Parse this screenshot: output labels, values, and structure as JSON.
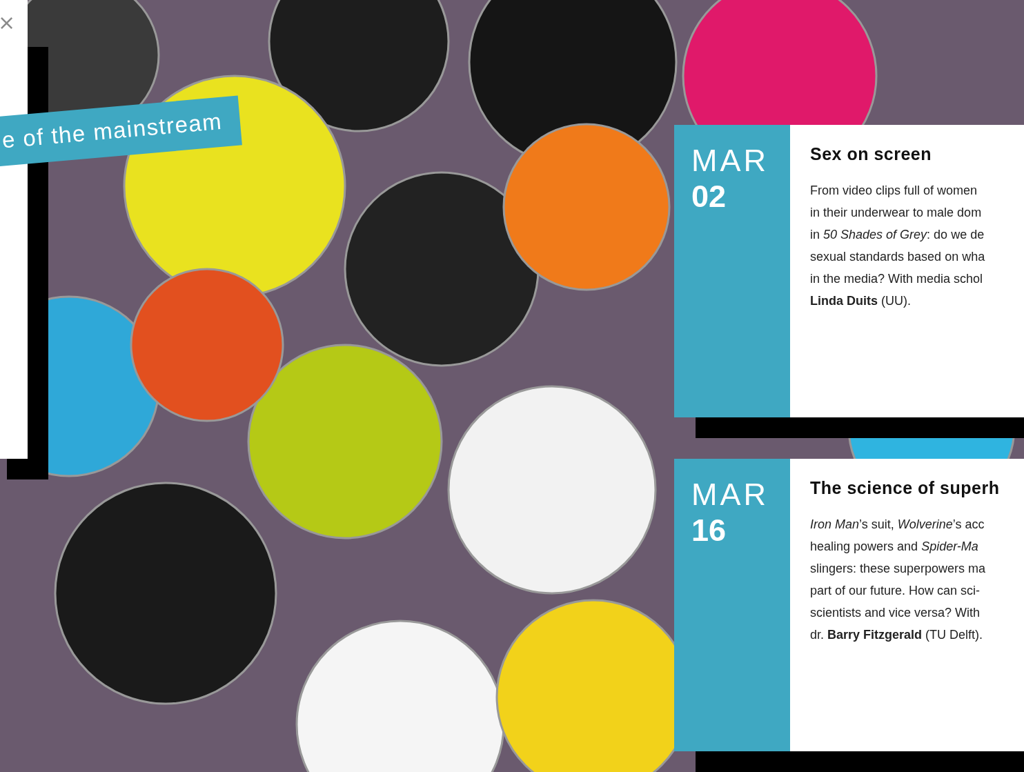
{
  "close_button": {
    "label": "×"
  },
  "banner": {
    "text": "e of the mainstream"
  },
  "events": [
    {
      "month": "MAR",
      "day": "02",
      "title": "Sex on screen",
      "lines": [
        "From video clips full of women",
        "in their underwear to male dom",
        "in *50 Shades of Grey*: do we de",
        "sexual standards based on wha",
        "in the media? With media schol",
        "**Linda Duits** (UU)."
      ]
    },
    {
      "month": "MAR",
      "day": "16",
      "title": "The science of superh",
      "lines": [
        "*Iron Man*’s suit, *Wolverine*’s acc",
        "healing powers and *Spider-Ma*",
        "slingers: these superpowers ma",
        "part of our future. How can sci-",
        "scientists and vice versa? With",
        "dr. **Barry Fitzgerald** (TU Delft)."
      ]
    }
  ]
}
